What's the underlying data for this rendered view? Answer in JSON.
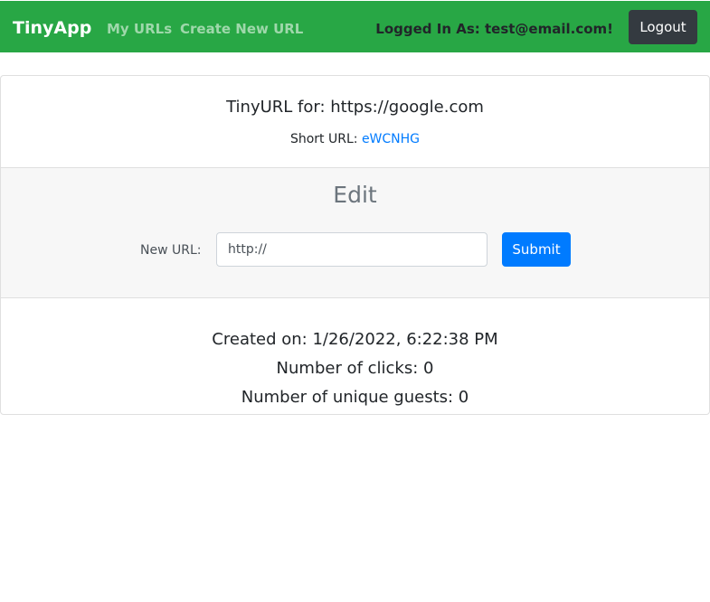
{
  "navbar": {
    "brand": "TinyApp",
    "links": {
      "my_urls": "My URLs",
      "create_new_url": "Create New URL"
    },
    "logged_in_text": "Logged In As: test@email.com!",
    "logout_label": "Logout",
    "background_color": "#28a745"
  },
  "url_info": {
    "title": "TinyURL for: https://google.com",
    "short_url_label": "Short URL: ",
    "short_url_value": "eWCNHG"
  },
  "edit": {
    "heading": "Edit",
    "new_url_label": "New URL:",
    "new_url_value": "",
    "new_url_placeholder": "http://",
    "submit_label": "Submit"
  },
  "stats": {
    "created_on": "Created on: 1/26/2022, 6:22:38 PM",
    "number_of_clicks": "Number of clicks: 0",
    "unique_guests": "Number of unique guests: 0"
  }
}
